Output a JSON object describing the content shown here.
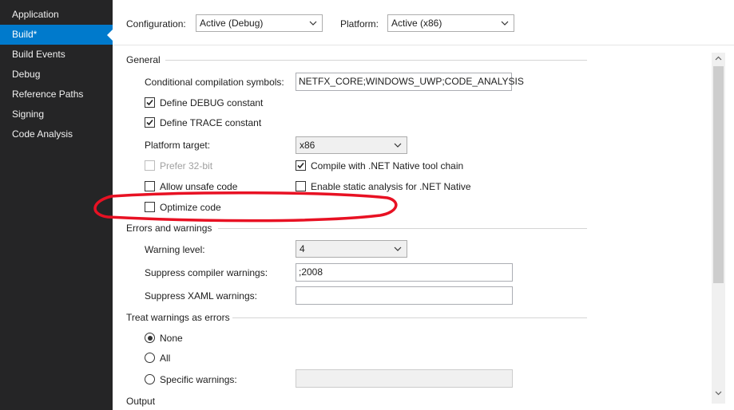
{
  "sidebar": {
    "items": [
      {
        "label": "Application"
      },
      {
        "label": "Build*"
      },
      {
        "label": "Build Events"
      },
      {
        "label": "Debug"
      },
      {
        "label": "Reference Paths"
      },
      {
        "label": "Signing"
      },
      {
        "label": "Code Analysis"
      }
    ],
    "active_index": 1
  },
  "topbar": {
    "configuration_label": "Configuration:",
    "configuration_value": "Active (Debug)",
    "platform_label": "Platform:",
    "platform_value": "Active (x86)"
  },
  "general": {
    "header": "General",
    "symbols_label": "Conditional compilation symbols:",
    "symbols_value": "NETFX_CORE;WINDOWS_UWP;CODE_ANALYSIS",
    "define_debug": {
      "label": "Define DEBUG constant",
      "checked": true
    },
    "define_trace": {
      "label": "Define TRACE constant",
      "checked": true
    },
    "platform_target_label": "Platform target:",
    "platform_target_value": "x86",
    "prefer32": {
      "label": "Prefer 32-bit",
      "checked": false,
      "disabled": true
    },
    "compile_native": {
      "label": "Compile with .NET Native tool chain",
      "checked": true
    },
    "allow_unsafe": {
      "label": "Allow unsafe code",
      "checked": false
    },
    "static_analysis": {
      "label": "Enable static analysis for .NET Native",
      "checked": false
    },
    "optimize": {
      "label": "Optimize code",
      "checked": false
    }
  },
  "errors": {
    "header": "Errors and warnings",
    "warning_level_label": "Warning level:",
    "warning_level_value": "4",
    "suppress_compiler_label": "Suppress compiler warnings:",
    "suppress_compiler_value": ";2008",
    "suppress_xaml_label": "Suppress XAML warnings:",
    "suppress_xaml_value": ""
  },
  "treat": {
    "header": "Treat warnings as errors",
    "none_label": "None",
    "all_label": "All",
    "specific_label": "Specific warnings:",
    "selected": "None"
  },
  "output": {
    "header": "Output"
  },
  "annotation": {
    "color": "#e81123"
  },
  "colors": {
    "sidebar_bg": "#252526",
    "accent": "#007acc"
  }
}
